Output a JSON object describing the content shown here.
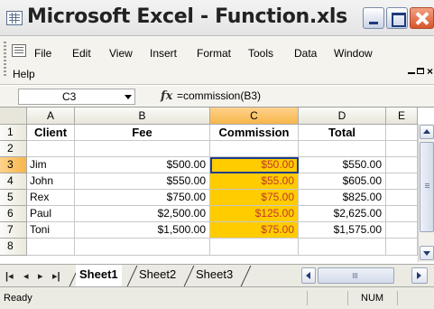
{
  "window": {
    "title": "Microsoft Excel - Function.xls"
  },
  "menu": {
    "items": [
      "File",
      "Edit",
      "View",
      "Insert",
      "Format",
      "Tools",
      "Data",
      "Window",
      "Help"
    ]
  },
  "formula_bar": {
    "name_box": "C3",
    "fx_symbol": "fx",
    "formula": "=commission(B3)"
  },
  "grid": {
    "columns": [
      "A",
      "B",
      "C",
      "D",
      "E"
    ],
    "rows": [
      "1",
      "2",
      "3",
      "4",
      "5",
      "6",
      "7",
      "8"
    ],
    "selected_column": "C",
    "selected_row": "3",
    "header": {
      "client": "Client",
      "fee": "Fee",
      "commission": "Commission",
      "total": "Total"
    },
    "data": [
      {
        "client": "Jim",
        "fee": "$500.00",
        "commission": "$50.00",
        "total": "$550.00"
      },
      {
        "client": "John",
        "fee": "$550.00",
        "commission": "$55.00",
        "total": "$605.00"
      },
      {
        "client": "Rex",
        "fee": "$750.00",
        "commission": "$75.00",
        "total": "$825.00"
      },
      {
        "client": "Paul",
        "fee": "$2,500.00",
        "commission": "$125.00",
        "total": "$2,625.00"
      },
      {
        "client": "Toni",
        "fee": "$1,500.00",
        "commission": "$75.00",
        "total": "$1,575.00"
      }
    ]
  },
  "sheets": {
    "tabs": [
      "Sheet1",
      "Sheet2",
      "Sheet3"
    ],
    "active": "Sheet1"
  },
  "status": {
    "left": "Ready",
    "num": "NUM"
  },
  "colors": {
    "highlight": "#ffcc00",
    "highlight_text": "#c0392b",
    "selected_header": "#f6b64b"
  }
}
